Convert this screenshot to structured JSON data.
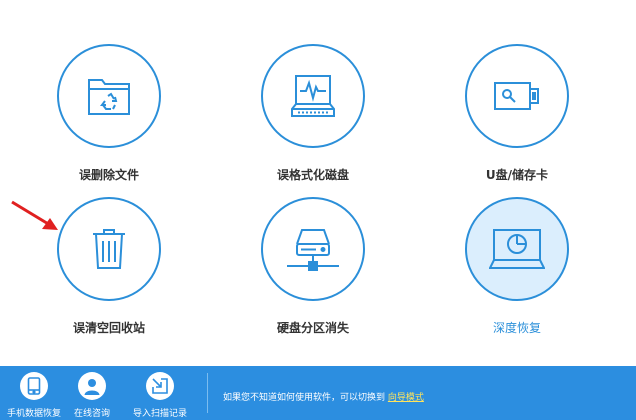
{
  "colors": {
    "accent": "#2b8fd9",
    "active_bg": "#dbeefd",
    "footer_bg": "#2c8ee0",
    "link": "#ffe45c",
    "arrow": "#e02020"
  },
  "tiles": [
    {
      "label": "误删除文件",
      "icon": "folder-recycle-icon"
    },
    {
      "label": "误格式化磁盘",
      "icon": "disk-pulse-icon"
    },
    {
      "label": "U盘/储存卡",
      "icon": "usb-drive-icon"
    },
    {
      "label": "误清空回收站",
      "icon": "trash-bin-icon"
    },
    {
      "label": "硬盘分区消失",
      "icon": "hard-drive-network-icon"
    },
    {
      "label": "深度恢复",
      "icon": "monitor-scan-icon"
    }
  ],
  "footer": {
    "buttons": [
      {
        "label": "手机数据恢复",
        "icon": "phone-icon"
      },
      {
        "label": "在线咨询",
        "icon": "user-avatar-icon"
      },
      {
        "label": "导入扫描记录",
        "icon": "import-icon"
      }
    ],
    "note": "如果您不知道如何使用软件，可以切换到",
    "link": "向导模式"
  }
}
